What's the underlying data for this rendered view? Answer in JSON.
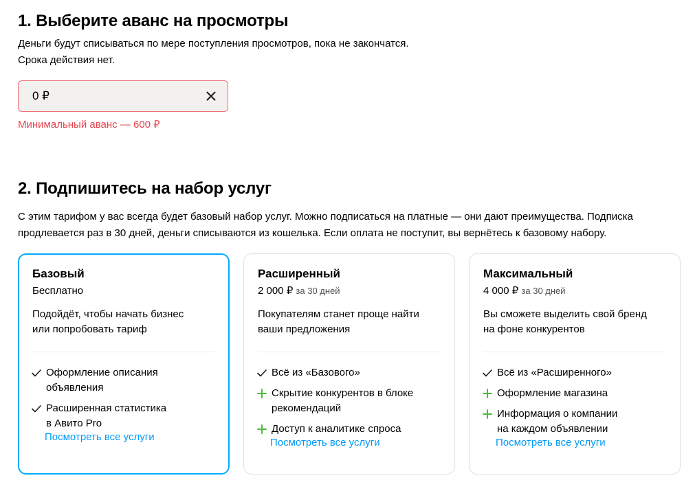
{
  "section1": {
    "title": "1. Выберите аванс на просмотры",
    "desc_line1": "Деньги будут списываться по мере поступления просмотров, пока не закончатся.",
    "desc_line2": "Срока действия нет.",
    "input_value": "0 ₽",
    "error": "Минимальный аванс — 600 ₽"
  },
  "section2": {
    "title": "2. Подпишитесь на набор услуг",
    "desc_line1": "С этим тарифом у вас всегда будет базовый набор услуг. Можно подписаться на платные — они дают преимущества. Подписка",
    "desc_line2": "продлевается раз в 30 дней, деньги списываются из кошелька. Если оплата не поступит, вы вернётесь к базовому набору."
  },
  "colors": {
    "accent": "#00aaff",
    "link": "#0099f7",
    "error": "#e5434d",
    "plus": "#4cbb3b"
  },
  "plans": [
    {
      "title": "Базовый",
      "price": "Бесплатно",
      "period": "",
      "selected": true,
      "desc_line1": "Подойдёт, чтобы начать бизнес",
      "desc_line2": "или попробовать тариф",
      "features": [
        {
          "icon": "check-icon",
          "line1": "Оформление описания",
          "line2": "объявления"
        },
        {
          "icon": "check-icon",
          "line1": "Расширенная статистика",
          "line2": "в Авито Pro"
        }
      ],
      "link": "Посмотреть все услуги"
    },
    {
      "title": "Расширенный",
      "price": "2 000 ₽",
      "period": "за 30 дней",
      "selected": false,
      "desc_line1": "Покупателям станет проще найти",
      "desc_line2": "ваши предложения",
      "features": [
        {
          "icon": "check-icon",
          "line1": "Всё из «Базового»",
          "line2": ""
        },
        {
          "icon": "plus-icon",
          "line1": "Скрытие конкурентов в блоке",
          "line2": "рекомендаций"
        },
        {
          "icon": "plus-icon",
          "line1": "Доступ к аналитике спроса",
          "line2": ""
        }
      ],
      "link": "Посмотреть все услуги"
    },
    {
      "title": "Максимальный",
      "price": "4 000 ₽",
      "period": "за 30 дней",
      "selected": false,
      "desc_line1": "Вы сможете выделить свой бренд",
      "desc_line2": "на фоне конкурентов",
      "features": [
        {
          "icon": "check-icon",
          "line1": "Всё из «Расширенного»",
          "line2": ""
        },
        {
          "icon": "plus-icon",
          "line1": "Оформление магазина",
          "line2": ""
        },
        {
          "icon": "plus-icon",
          "line1": "Информация о компании",
          "line2": "на каждом объявлении"
        }
      ],
      "link": "Посмотреть все услуги"
    }
  ]
}
